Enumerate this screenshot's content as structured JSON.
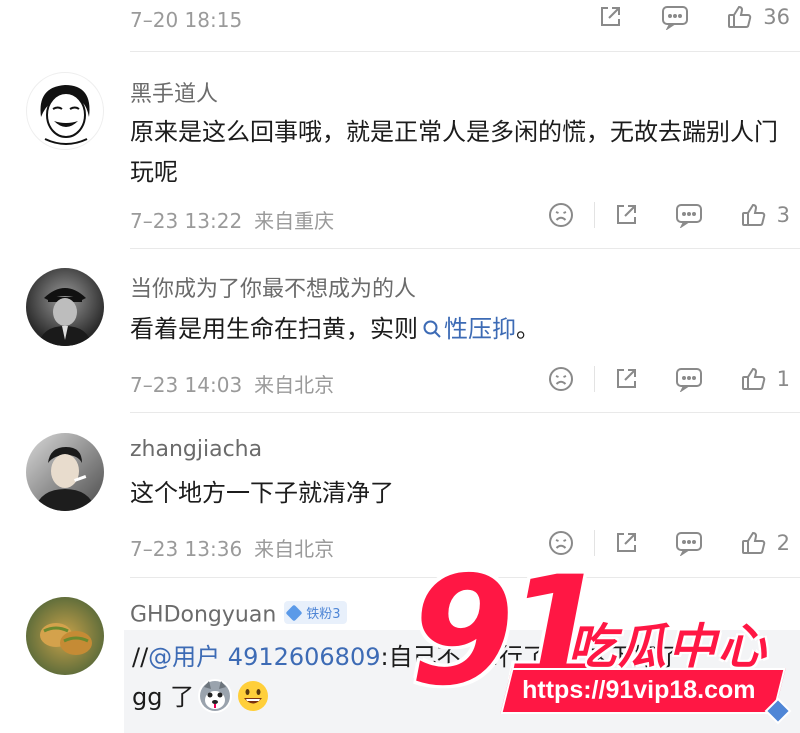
{
  "colors": {
    "accent_link": "#3d6bb5",
    "badge_bg": "#e8f0fb",
    "watermark_red": "#ff1744"
  },
  "top_row": {
    "timestamp": "7–20 18:15",
    "like_count": "36"
  },
  "comments": [
    {
      "username": "黑手道人",
      "text": "原来是这么回事哦，就是正常人是多闲的慌，无故去踹别人门玩呢",
      "timestamp": "7–23 13:22",
      "location": "来自重庆",
      "like_count": "3"
    },
    {
      "username": "当你成为了你最不想成为的人",
      "text_before": "看着是用生命在扫黄，实则",
      "topic": "性压抑",
      "text_after": "。",
      "timestamp": "7–23 14:03",
      "location": "来自北京",
      "like_count": "1"
    },
    {
      "username": "zhangjiacha",
      "text": "这个地方一下子就清净了",
      "timestamp": "7–23 13:36",
      "location": "来自北京",
      "like_count": "2"
    },
    {
      "username": "GHDongyuan",
      "badge": "铁粉3",
      "reply_prefix": "//",
      "mention": "@用户 4912606809",
      "quote_text": ":自己不.....行了.....这下好了",
      "line2": "gg 了"
    }
  ],
  "watermark": {
    "number": "91",
    "title": "吃瓜中心",
    "url": "https://91vip18.com"
  },
  "icons": [
    "share-icon",
    "comment-icon",
    "like-icon",
    "dislike-icon"
  ]
}
